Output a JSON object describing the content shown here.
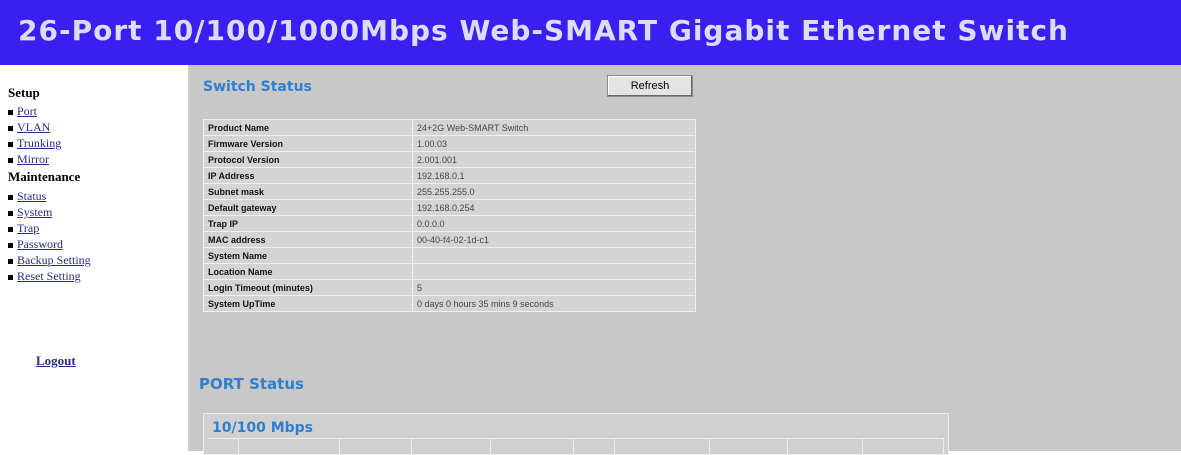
{
  "banner": {
    "title": "26-Port 10/100/1000Mbps Web-SMART Gigabit Ethernet Switch"
  },
  "sidebar": {
    "setup_heading": "Setup",
    "setup_items": [
      {
        "label": "Port"
      },
      {
        "label": "VLAN"
      },
      {
        "label": "Trunking"
      },
      {
        "label": "Mirror"
      }
    ],
    "maintenance_heading": "Maintenance",
    "maintenance_items": [
      {
        "label": "Status"
      },
      {
        "label": "System"
      },
      {
        "label": "Trap"
      },
      {
        "label": "Password"
      },
      {
        "label": "Backup Setting"
      },
      {
        "label": "Reset Setting"
      }
    ],
    "logout_label": "Logout"
  },
  "switch_status": {
    "title": "Switch Status",
    "refresh_label": "Refresh",
    "rows": [
      {
        "label": "Product Name",
        "value": "24+2G Web-SMART Switch"
      },
      {
        "label": "Firmware Version",
        "value": "1.00.03"
      },
      {
        "label": "Protocol Version",
        "value": "2.001.001"
      },
      {
        "label": "IP Address",
        "value": "192.168.0.1"
      },
      {
        "label": "Subnet mask",
        "value": "255.255.255.0"
      },
      {
        "label": "Default gateway",
        "value": "192.168.0.254"
      },
      {
        "label": "Trap IP",
        "value": "0.0.0.0"
      },
      {
        "label": "MAC address",
        "value": "00-40-f4-02-1d-c1"
      },
      {
        "label": "System Name",
        "value": ""
      },
      {
        "label": "Location Name",
        "value": ""
      },
      {
        "label": "Login Timeout (minutes)",
        "value": "5"
      },
      {
        "label": "System UpTime",
        "value": "0 days 0 hours 35 mins 9 seconds"
      }
    ]
  },
  "port_status": {
    "title": "PORT Status",
    "subtitle": "10/100 Mbps"
  },
  "colors": {
    "banner_bg": "#3a1ff0",
    "banner_text": "#dcdcff",
    "section_title": "#2f7fd0",
    "main_bg": "#c8c8c8"
  }
}
